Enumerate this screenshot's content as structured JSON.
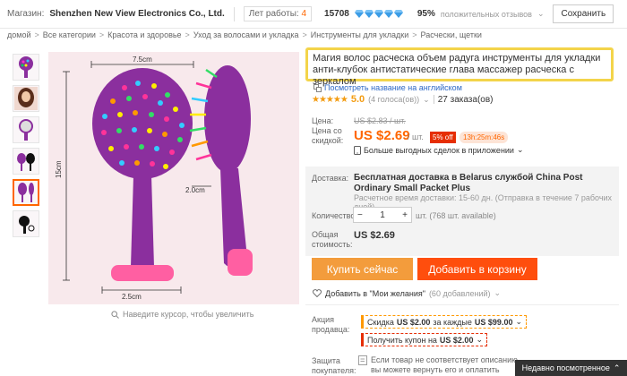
{
  "store": {
    "label": "Магазин:",
    "name": "Shenzhen New View Electronics Co., Ltd.",
    "years_label": "Лет работы:",
    "years_value": "4",
    "score": "15708",
    "positive_pct": "95%",
    "positive_label": "положительных отзывов",
    "save_label": "Сохранить"
  },
  "breadcrumb": [
    "домой",
    "Все категории",
    "Красота и здоровье",
    "Уход за волосами и укладка",
    "Инструменты для укладки",
    "Расчески, щетки"
  ],
  "product": {
    "title": "Магия волос расческа объем радуга инструменты для укладки анти-клубок антистатические глава массажер расческа с зеркалом",
    "translate_link": "Посмотреть название на английском",
    "rating_value": "5.0",
    "votes": "(4 голоса(ов))",
    "orders": "27 заказа(ов)"
  },
  "image": {
    "dim_top": "7.5cm",
    "dim_height": "15cm",
    "dim_handle": "2.0cm",
    "dim_bottom": "2.5cm",
    "zoom_hint": "Наведите курсор, чтобы увеличить"
  },
  "price": {
    "old_label": "Цена:",
    "old_value": "US $2.83 / шт.",
    "disc_label": "Цена со скидкой:",
    "value": "US $2.69",
    "per": "/ шт.",
    "off": "5% off",
    "timer": "13h:25m:46s",
    "more_deals": "Больше выгодных сделок в приложении"
  },
  "shipping": {
    "label": "Доставка:",
    "text": "Бесплатная доставка в Belarus службой China Post Ordinary Small Packet Plus",
    "time": "Расчетное время доставки: 15-60 дн. (Отправка в течение 7 рабочих дней)"
  },
  "quantity": {
    "label": "Количество:",
    "value": "1",
    "minus": "−",
    "plus": "+",
    "note": "шт. (768 шт. available)"
  },
  "total": {
    "label": "Общая стоимость:",
    "value": "US $2.69"
  },
  "actions": {
    "buy_now": "Купить сейчас",
    "add_to_cart": "Добавить в корзину",
    "wishlist": "Добавить в \"Мои желания\"",
    "wishlist_count": "(60 добавлений)"
  },
  "promo": {
    "label": "Акция продавца:",
    "discount_prefix": "Скидка",
    "discount_amount": "US $2.00",
    "discount_mid": "за каждые",
    "discount_threshold": "US $99.00",
    "coupon_prefix": "Получить купон на",
    "coupon_amount": "US $2.00"
  },
  "protection": {
    "label": "Защита покупателя:",
    "text": "Если товар не соответствует описанию, вы можете вернуть его и оплатить стоимость обратной пересылки, или"
  },
  "recently_viewed": "Недавно посмотренное",
  "colors": {
    "accent": "#ff6600",
    "buy_button": "#f39c3c",
    "cart_button": "#ff4e0d",
    "highlight_border": "#f3d44a",
    "diamond": "#3c9de6",
    "brush_purple": "#8b2f9e"
  }
}
